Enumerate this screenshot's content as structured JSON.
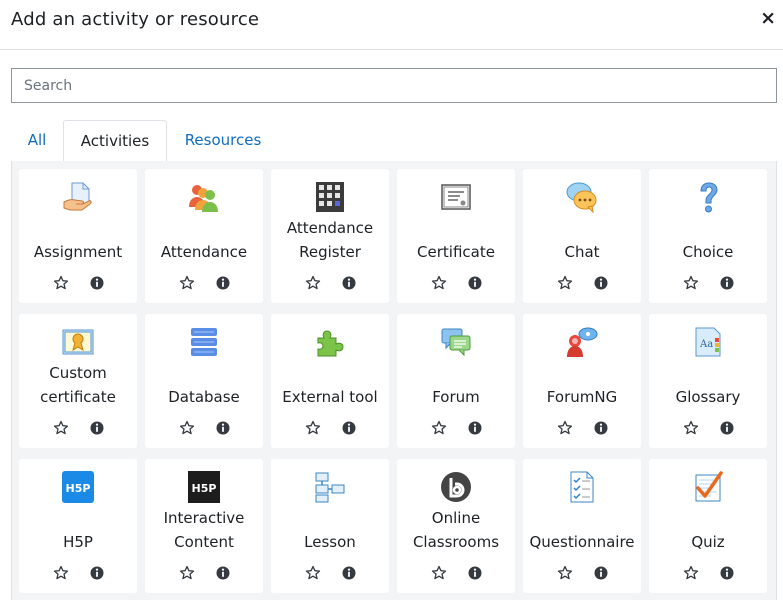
{
  "dialog": {
    "title": "Add an activity or resource",
    "close_glyph": "×"
  },
  "search": {
    "placeholder": "Search",
    "value": ""
  },
  "tabs": [
    {
      "label": "All",
      "active": false
    },
    {
      "label": "Activities",
      "active": true
    },
    {
      "label": "Resources",
      "active": false
    }
  ],
  "modules": [
    {
      "name": "Assignment",
      "lines": [
        "Assignment"
      ],
      "icon": "assignment-icon"
    },
    {
      "name": "Attendance",
      "lines": [
        "Attendance"
      ],
      "icon": "attendance-icon"
    },
    {
      "name": "Attendance Register",
      "lines": [
        "Attendance",
        "Register"
      ],
      "icon": "attendance-register-icon"
    },
    {
      "name": "Certificate",
      "lines": [
        "Certificate"
      ],
      "icon": "certificate-icon"
    },
    {
      "name": "Chat",
      "lines": [
        "Chat"
      ],
      "icon": "chat-icon"
    },
    {
      "name": "Choice",
      "lines": [
        "Choice"
      ],
      "icon": "choice-icon"
    },
    {
      "name": "Custom certificate",
      "lines": [
        "Custom",
        "certificate"
      ],
      "icon": "custom-certificate-icon"
    },
    {
      "name": "Database",
      "lines": [
        "Database"
      ],
      "icon": "database-icon"
    },
    {
      "name": "External tool",
      "lines": [
        "External tool"
      ],
      "icon": "external-tool-icon"
    },
    {
      "name": "Forum",
      "lines": [
        "Forum"
      ],
      "icon": "forum-icon"
    },
    {
      "name": "ForumNG",
      "lines": [
        "ForumNG"
      ],
      "icon": "forumng-icon"
    },
    {
      "name": "Glossary",
      "lines": [
        "Glossary"
      ],
      "icon": "glossary-icon"
    },
    {
      "name": "H5P",
      "lines": [
        "H5P"
      ],
      "icon": "h5p-icon"
    },
    {
      "name": "Interactive Content",
      "lines": [
        "Interactive",
        "Content"
      ],
      "icon": "interactive-content-icon"
    },
    {
      "name": "Lesson",
      "lines": [
        "Lesson"
      ],
      "icon": "lesson-icon"
    },
    {
      "name": "Online Classrooms",
      "lines": [
        "Online",
        "Classrooms"
      ],
      "icon": "online-classrooms-icon"
    },
    {
      "name": "Questionnaire",
      "lines": [
        "Questionnaire"
      ],
      "icon": "questionnaire-icon"
    },
    {
      "name": "Quiz",
      "lines": [
        "Quiz"
      ],
      "icon": "quiz-icon"
    }
  ],
  "card_actions": {
    "star_icon": "star-outline-icon",
    "info_icon": "info-icon"
  }
}
